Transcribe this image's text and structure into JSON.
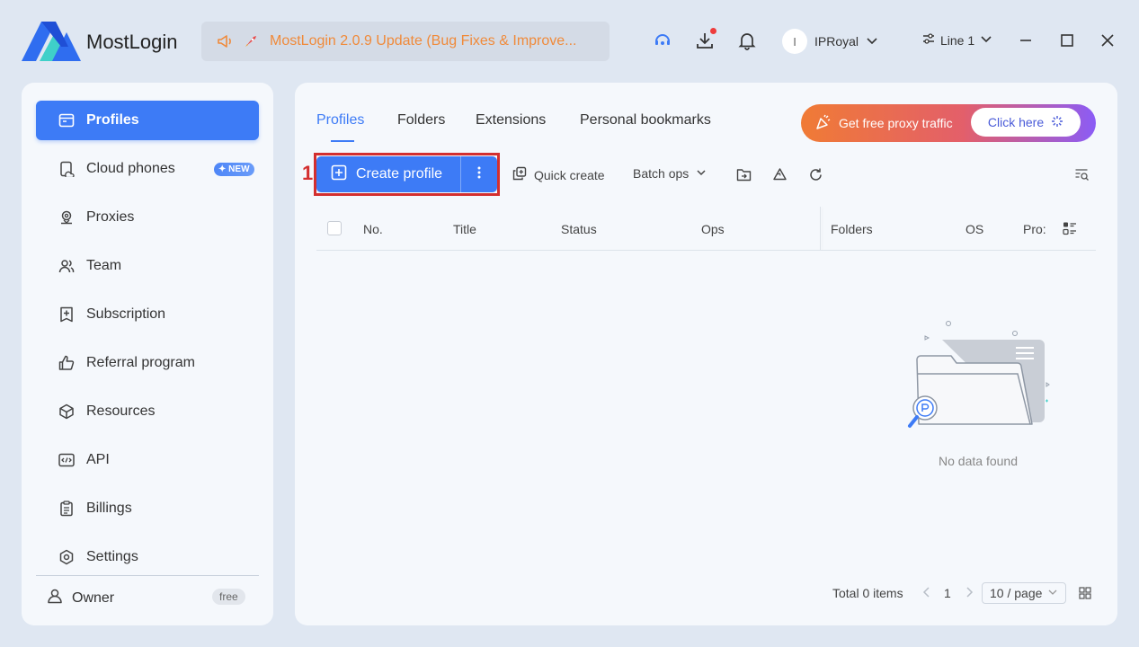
{
  "app": {
    "name": "MostLogin",
    "announcement": "MostLogin 2.0.9 Update (Bug Fixes & Improve..."
  },
  "header": {
    "user_initial": "I",
    "user_name": "IPRoyal",
    "line_label": "Line 1"
  },
  "sidebar": {
    "items": [
      {
        "label": "Profiles",
        "icon": "profile-card-icon"
      },
      {
        "label": "Cloud phones",
        "icon": "cloud-phone-icon",
        "badge": "NEW"
      },
      {
        "label": "Proxies",
        "icon": "proxy-pin-icon"
      },
      {
        "label": "Team",
        "icon": "team-icon"
      },
      {
        "label": "Subscription",
        "icon": "subscription-icon"
      },
      {
        "label": "Referral program",
        "icon": "thumbs-up-icon"
      },
      {
        "label": "Resources",
        "icon": "cube-icon"
      },
      {
        "label": "API",
        "icon": "code-icon"
      },
      {
        "label": "Billings",
        "icon": "clipboard-icon"
      },
      {
        "label": "Settings",
        "icon": "gear-icon"
      }
    ],
    "owner_label": "Owner",
    "owner_plan": "free"
  },
  "main": {
    "tabs": [
      "Profiles",
      "Folders",
      "Extensions",
      "Personal bookmarks"
    ],
    "promo_text": "Get free proxy traffic",
    "promo_button": "Click here",
    "step_marker": "1",
    "create_profile": "Create profile",
    "quick_create": "Quick create",
    "batch_ops": "Batch ops",
    "columns": [
      "No.",
      "Title",
      "Status",
      "Ops",
      "Folders",
      "OS",
      "Pro:"
    ],
    "empty_text": "No data found",
    "total": "Total 0 items",
    "page": "1",
    "page_size": "10 / page"
  },
  "colors": {
    "accent": "#3d7bf6",
    "highlight": "#d32f2f",
    "announcement": "#f08a3a"
  }
}
